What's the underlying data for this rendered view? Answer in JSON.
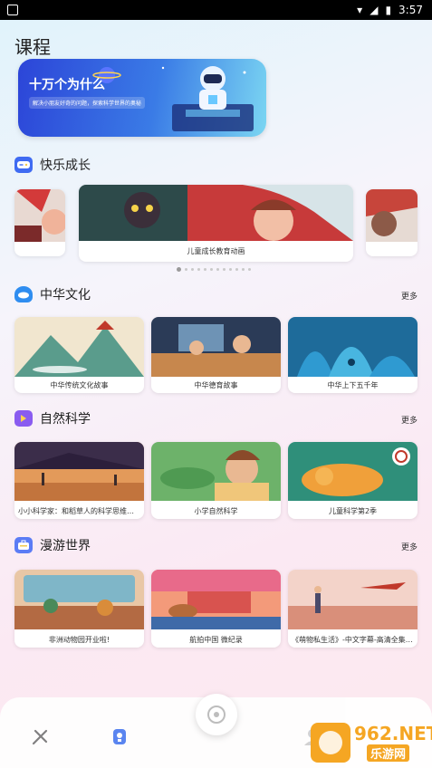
{
  "status_bar": {
    "time": "3:57"
  },
  "page": {
    "title": "课程"
  },
  "banner": {
    "title": "十万个为什么",
    "subtitle": "解决小朋友好奇的问题，探索科学世界的奥秘"
  },
  "sections": {
    "growth": {
      "title": "快乐成长",
      "carousel_caption": "儿童成长教育动画",
      "dot_count": 12,
      "active_dot": 0
    },
    "culture": {
      "title": "中华文化",
      "more": "更多",
      "items": [
        {
          "label": "中华传统文化故事"
        },
        {
          "label": "中华德育故事"
        },
        {
          "label": "中华上下五千年"
        }
      ]
    },
    "science": {
      "title": "自然科学",
      "more": "更多",
      "items": [
        {
          "label": "小小科学家：和稻草人的科学思维启蒙课"
        },
        {
          "label": "小学自然科学"
        },
        {
          "label": "儿童科学第2季"
        }
      ]
    },
    "world": {
      "title": "漫游世界",
      "more": "更多",
      "items": [
        {
          "label": "非洲动物园开业啦!"
        },
        {
          "label": "航拍中国 微纪录"
        },
        {
          "label": "《萌物私生活》-中文字幕-高清全集-The P..."
        }
      ]
    }
  },
  "watermark": {
    "brand": "962.NET",
    "subtitle": "乐游网"
  }
}
